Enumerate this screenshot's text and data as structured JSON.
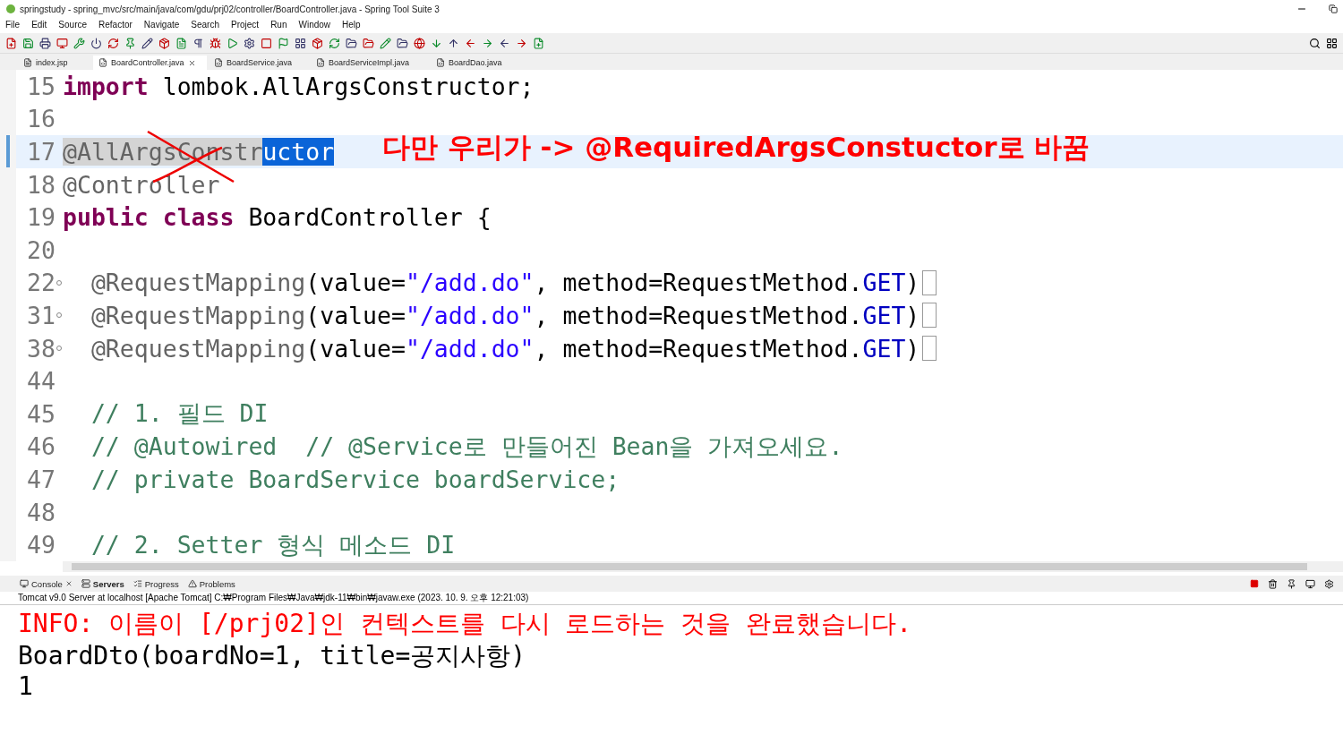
{
  "window": {
    "title": "springstudy - spring_mvc/src/main/java/com/gdu/prj02/controller/BoardController.java - Spring Tool Suite 3"
  },
  "menu": [
    "File",
    "Edit",
    "Source",
    "Refactor",
    "Navigate",
    "Search",
    "Project",
    "Run",
    "Window",
    "Help"
  ],
  "tabs": [
    {
      "label": "index.jsp",
      "selected": false
    },
    {
      "label": "BoardController.java",
      "selected": true
    },
    {
      "label": "BoardService.java",
      "selected": false
    },
    {
      "label": "BoardServiceImpl.java",
      "selected": false
    },
    {
      "label": "BoardDao.java",
      "selected": false
    }
  ],
  "editor": {
    "lines": [
      {
        "number": "15",
        "folded": false,
        "current": false,
        "tokens": [
          {
            "kind": "keyword",
            "text": "import"
          },
          {
            "kind": "plain",
            "text": " lombok.AllArgsConstructor;"
          }
        ]
      },
      {
        "number": "16",
        "folded": false,
        "current": false
      },
      {
        "number": "17",
        "folded": false,
        "current": true,
        "tokens": [
          {
            "kind": "annotation",
            "text": "@AllArgsConstr",
            "marked": true,
            "selected": false
          },
          {
            "kind": "annotation",
            "text": "uctor",
            "selected": true
          }
        ]
      },
      {
        "number": "18",
        "folded": false,
        "current": false,
        "tokens": [
          {
            "kind": "annotation",
            "text": "@Controller"
          }
        ]
      },
      {
        "number": "19",
        "folded": false,
        "current": false,
        "tokens": [
          {
            "kind": "keyword",
            "text": "public class"
          },
          {
            "kind": "plain",
            "text": " BoardController {"
          }
        ]
      },
      {
        "number": "20",
        "folded": false,
        "current": false
      },
      {
        "number": "22",
        "folded": true,
        "current": false,
        "tokens": [
          {
            "kind": "annotation",
            "text": "  @RequestMapping"
          },
          {
            "kind": "plain",
            "text": "(value="
          },
          {
            "kind": "string",
            "text": "\"/add.do\""
          },
          {
            "kind": "plain",
            "text": ", method=RequestMethod."
          },
          {
            "kind": "constant",
            "text": "GET"
          },
          {
            "kind": "plain",
            "text": ")"
          }
        ]
      },
      {
        "number": "31",
        "folded": true,
        "current": false,
        "tokens": [
          {
            "kind": "annotation",
            "text": "  @RequestMapping"
          },
          {
            "kind": "plain",
            "text": "(value="
          },
          {
            "kind": "string",
            "text": "\"/add.do\""
          },
          {
            "kind": "plain",
            "text": ", method=RequestMethod."
          },
          {
            "kind": "constant",
            "text": "GET"
          },
          {
            "kind": "plain",
            "text": ")"
          }
        ]
      },
      {
        "number": "38",
        "folded": true,
        "current": false,
        "tokens": [
          {
            "kind": "annotation",
            "text": "  @RequestMapping"
          },
          {
            "kind": "plain",
            "text": "(value="
          },
          {
            "kind": "string",
            "text": "\"/add.do\""
          },
          {
            "kind": "plain",
            "text": ", method=RequestMethod."
          },
          {
            "kind": "constant",
            "text": "GET"
          },
          {
            "kind": "plain",
            "text": ")"
          }
        ]
      },
      {
        "number": "44",
        "folded": false,
        "current": false
      },
      {
        "number": "45",
        "folded": false,
        "current": false,
        "tokens": [
          {
            "kind": "comment",
            "text": "  // 1. 필드 DI"
          }
        ]
      },
      {
        "number": "46",
        "folded": false,
        "current": false,
        "tokens": [
          {
            "kind": "comment",
            "text": "  // @Autowired  // @Service로 만들어진 Bean을 가져오세요."
          }
        ]
      },
      {
        "number": "47",
        "folded": false,
        "current": false,
        "tokens": [
          {
            "kind": "comment",
            "text": "  // private BoardService boardService;"
          }
        ]
      },
      {
        "number": "48",
        "folded": false,
        "current": false
      },
      {
        "number": "49",
        "folded": false,
        "current": false,
        "tokens": [
          {
            "kind": "comment",
            "text": "  // 2. Setter 형식 메소드 DI"
          }
        ]
      }
    ],
    "note": "다만 우리가 -> @RequiredArgsConstuctor로 바꿈"
  },
  "console": {
    "tabs": [
      {
        "label": "Console",
        "selected": false
      },
      {
        "label": "Servers",
        "selected": true
      },
      {
        "label": "Progress",
        "selected": false
      },
      {
        "label": "Problems",
        "selected": false
      }
    ],
    "header": "Tomcat v9.0 Server at localhost [Apache Tomcat] C:₩Program Files₩Java₩jdk-11₩bin₩javaw.exe  (2023. 10. 9. 오후 12:21:03)",
    "output": [
      {
        "kind": "error",
        "text": "INFO: 이름이 [/prj02]인 컨텍스트를 다시 로드하는 것을 완료했습니다."
      },
      {
        "kind": "plain",
        "text": "BoardDto(boardNo=1, title=공지사항)"
      },
      {
        "kind": "plain",
        "text": "1"
      }
    ]
  }
}
